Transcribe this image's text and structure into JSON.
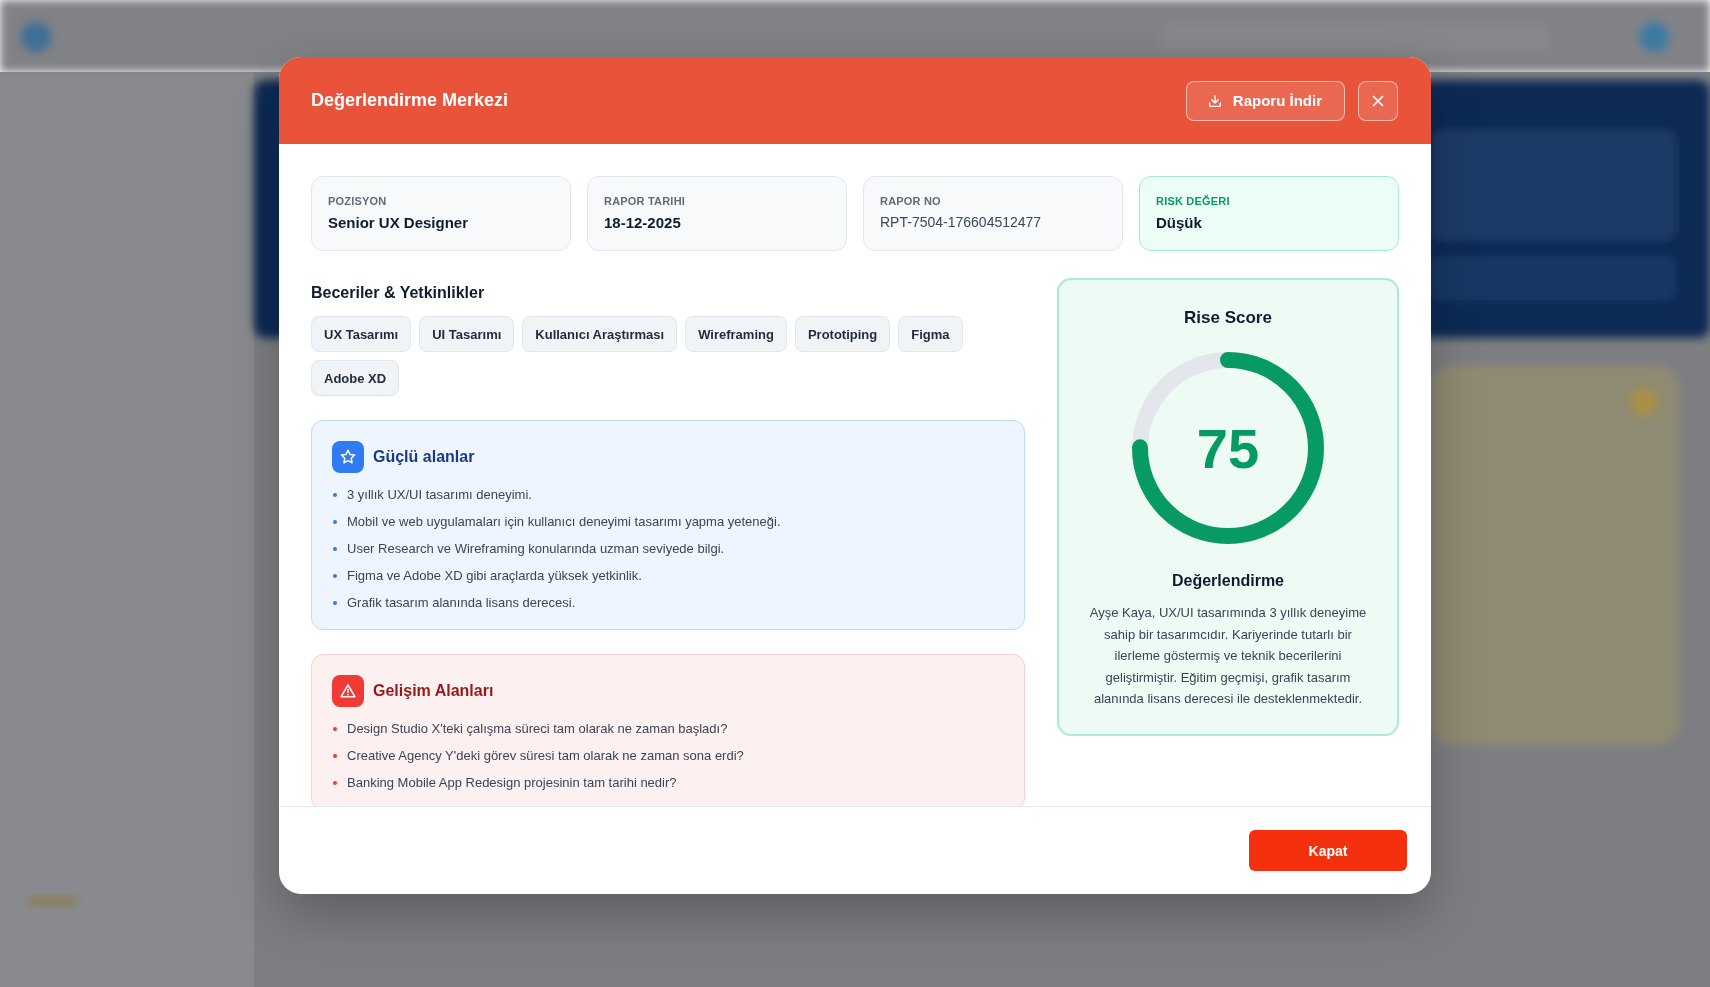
{
  "modal": {
    "title": "Değerlendirme Merkezi",
    "download_button": "Raporu İndir",
    "info_cards": [
      {
        "kind": "default",
        "label": "POZISYON",
        "value": "Senior UX Designer"
      },
      {
        "kind": "default",
        "label": "RAPOR TARIHI",
        "value": "18-12-2025"
      },
      {
        "kind": "mono",
        "label": "RAPOR NO",
        "value": "RPT-7504-176604512477"
      },
      {
        "kind": "success",
        "label": "RISK DEĞERI",
        "value": "Düşük"
      }
    ],
    "skills": {
      "title": "Beceriler & Yetkinlikler",
      "items": [
        "UX Tasarımı",
        "UI Tasarımı",
        "Kullanıcı Araştırması",
        "Wireframing",
        "Prototiping",
        "Figma",
        "Adobe XD"
      ]
    },
    "sections": [
      {
        "kind": "strength",
        "title": "Güçlü alanlar",
        "items": [
          "3 yıllık UX/UI tasarımı deneyimi.",
          "Mobil ve web uygulamaları için kullanıcı deneyimi tasarımı yapma yeteneği.",
          "User Research ve Wireframing konularında uzman seviyede bilgi.",
          "Figma ve Adobe XD gibi araçlarda yüksek yetkinlik.",
          "Grafik tasarım alanında lisans derecesi."
        ]
      },
      {
        "kind": "improvement",
        "title": "Gelişim Alanları",
        "items": [
          "Design Studio X'teki çalışma süreci tam olarak ne zaman başladı?",
          "Creative Agency Y'deki görev süresi tam olarak ne zaman sona erdi?",
          "Banking Mobile App Redesign projesinin tam tarihi nedir?"
        ]
      }
    ],
    "score_card": {
      "title": "Rise Score",
      "score": "75",
      "level": 0.75,
      "subtitle": "Değerlendirme",
      "summary": "Ayşe Kaya, UX/UI tasarımında 3 yıllık deneyime sahip bir tasarımcıdır. Kariyerinde tutarlı bir ilerleme göstermiş ve teknik becerilerini geliştirmiştir. Eğitim geçmişi, grafik tasarım alanında lisans derecesi ile desteklenmektedir."
    },
    "close_button": "Kapat"
  }
}
